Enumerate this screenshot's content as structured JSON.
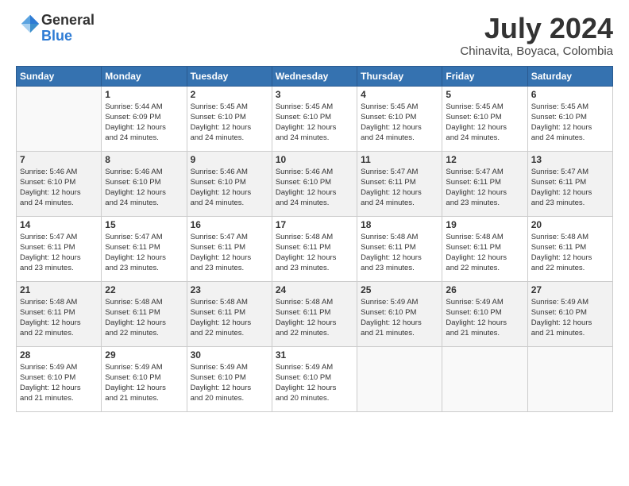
{
  "logo": {
    "general": "General",
    "blue": "Blue"
  },
  "title": "July 2024",
  "location": "Chinavita, Boyaca, Colombia",
  "days_header": [
    "Sunday",
    "Monday",
    "Tuesday",
    "Wednesday",
    "Thursday",
    "Friday",
    "Saturday"
  ],
  "weeks": [
    [
      {
        "day": "",
        "info": ""
      },
      {
        "day": "1",
        "info": "Sunrise: 5:44 AM\nSunset: 6:09 PM\nDaylight: 12 hours\nand 24 minutes."
      },
      {
        "day": "2",
        "info": "Sunrise: 5:45 AM\nSunset: 6:10 PM\nDaylight: 12 hours\nand 24 minutes."
      },
      {
        "day": "3",
        "info": "Sunrise: 5:45 AM\nSunset: 6:10 PM\nDaylight: 12 hours\nand 24 minutes."
      },
      {
        "day": "4",
        "info": "Sunrise: 5:45 AM\nSunset: 6:10 PM\nDaylight: 12 hours\nand 24 minutes."
      },
      {
        "day": "5",
        "info": "Sunrise: 5:45 AM\nSunset: 6:10 PM\nDaylight: 12 hours\nand 24 minutes."
      },
      {
        "day": "6",
        "info": "Sunrise: 5:45 AM\nSunset: 6:10 PM\nDaylight: 12 hours\nand 24 minutes."
      }
    ],
    [
      {
        "day": "7",
        "info": "Sunrise: 5:46 AM\nSunset: 6:10 PM\nDaylight: 12 hours\nand 24 minutes."
      },
      {
        "day": "8",
        "info": "Sunrise: 5:46 AM\nSunset: 6:10 PM\nDaylight: 12 hours\nand 24 minutes."
      },
      {
        "day": "9",
        "info": "Sunrise: 5:46 AM\nSunset: 6:10 PM\nDaylight: 12 hours\nand 24 minutes."
      },
      {
        "day": "10",
        "info": "Sunrise: 5:46 AM\nSunset: 6:10 PM\nDaylight: 12 hours\nand 24 minutes."
      },
      {
        "day": "11",
        "info": "Sunrise: 5:47 AM\nSunset: 6:11 PM\nDaylight: 12 hours\nand 24 minutes."
      },
      {
        "day": "12",
        "info": "Sunrise: 5:47 AM\nSunset: 6:11 PM\nDaylight: 12 hours\nand 23 minutes."
      },
      {
        "day": "13",
        "info": "Sunrise: 5:47 AM\nSunset: 6:11 PM\nDaylight: 12 hours\nand 23 minutes."
      }
    ],
    [
      {
        "day": "14",
        "info": "Sunrise: 5:47 AM\nSunset: 6:11 PM\nDaylight: 12 hours\nand 23 minutes."
      },
      {
        "day": "15",
        "info": "Sunrise: 5:47 AM\nSunset: 6:11 PM\nDaylight: 12 hours\nand 23 minutes."
      },
      {
        "day": "16",
        "info": "Sunrise: 5:47 AM\nSunset: 6:11 PM\nDaylight: 12 hours\nand 23 minutes."
      },
      {
        "day": "17",
        "info": "Sunrise: 5:48 AM\nSunset: 6:11 PM\nDaylight: 12 hours\nand 23 minutes."
      },
      {
        "day": "18",
        "info": "Sunrise: 5:48 AM\nSunset: 6:11 PM\nDaylight: 12 hours\nand 23 minutes."
      },
      {
        "day": "19",
        "info": "Sunrise: 5:48 AM\nSunset: 6:11 PM\nDaylight: 12 hours\nand 22 minutes."
      },
      {
        "day": "20",
        "info": "Sunrise: 5:48 AM\nSunset: 6:11 PM\nDaylight: 12 hours\nand 22 minutes."
      }
    ],
    [
      {
        "day": "21",
        "info": "Sunrise: 5:48 AM\nSunset: 6:11 PM\nDaylight: 12 hours\nand 22 minutes."
      },
      {
        "day": "22",
        "info": "Sunrise: 5:48 AM\nSunset: 6:11 PM\nDaylight: 12 hours\nand 22 minutes."
      },
      {
        "day": "23",
        "info": "Sunrise: 5:48 AM\nSunset: 6:11 PM\nDaylight: 12 hours\nand 22 minutes."
      },
      {
        "day": "24",
        "info": "Sunrise: 5:48 AM\nSunset: 6:11 PM\nDaylight: 12 hours\nand 22 minutes."
      },
      {
        "day": "25",
        "info": "Sunrise: 5:49 AM\nSunset: 6:10 PM\nDaylight: 12 hours\nand 21 minutes."
      },
      {
        "day": "26",
        "info": "Sunrise: 5:49 AM\nSunset: 6:10 PM\nDaylight: 12 hours\nand 21 minutes."
      },
      {
        "day": "27",
        "info": "Sunrise: 5:49 AM\nSunset: 6:10 PM\nDaylight: 12 hours\nand 21 minutes."
      }
    ],
    [
      {
        "day": "28",
        "info": "Sunrise: 5:49 AM\nSunset: 6:10 PM\nDaylight: 12 hours\nand 21 minutes."
      },
      {
        "day": "29",
        "info": "Sunrise: 5:49 AM\nSunset: 6:10 PM\nDaylight: 12 hours\nand 21 minutes."
      },
      {
        "day": "30",
        "info": "Sunrise: 5:49 AM\nSunset: 6:10 PM\nDaylight: 12 hours\nand 20 minutes."
      },
      {
        "day": "31",
        "info": "Sunrise: 5:49 AM\nSunset: 6:10 PM\nDaylight: 12 hours\nand 20 minutes."
      },
      {
        "day": "",
        "info": ""
      },
      {
        "day": "",
        "info": ""
      },
      {
        "day": "",
        "info": ""
      }
    ]
  ]
}
